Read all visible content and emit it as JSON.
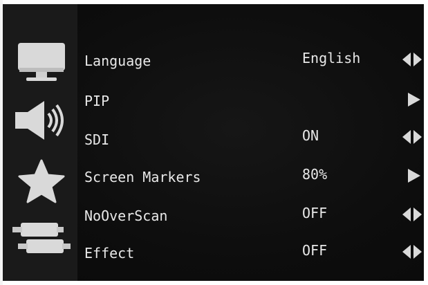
{
  "sidebar": {
    "icons": [
      "monitor-icon",
      "speaker-icon",
      "star-icon",
      "connector-icon"
    ]
  },
  "menu": {
    "rows": [
      {
        "label": "Language",
        "value": "English",
        "arrow": "left-right-arrow-icon"
      },
      {
        "label": "PIP",
        "value": "",
        "arrow": "right-arrow-icon"
      },
      {
        "label": "SDI",
        "value": "ON",
        "arrow": "left-right-arrow-icon"
      },
      {
        "label": "Screen Markers",
        "value": "80%",
        "arrow": "right-arrow-icon"
      },
      {
        "label": "NoOverScan",
        "value": "OFF",
        "arrow": "left-right-arrow-icon"
      },
      {
        "label": "Effect",
        "value": "OFF",
        "arrow": "left-right-arrow-icon"
      }
    ]
  },
  "colors": {
    "background": "#0d0d0d",
    "sidebar": "#1a1a1a",
    "text": "#e8e8e8",
    "icon": "#d9d9d9"
  }
}
